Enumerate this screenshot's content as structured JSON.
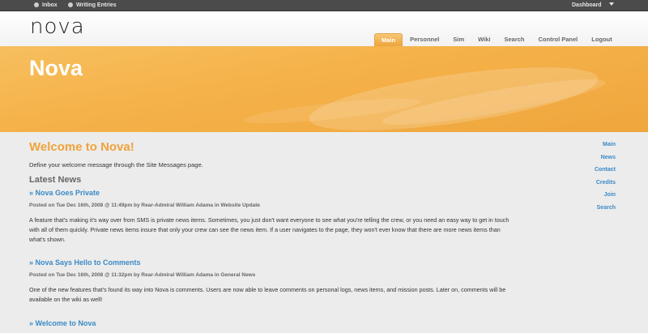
{
  "topbar": {
    "inbox": "Inbox",
    "writing_entries": "Writing Entries",
    "dashboard": "Dashboard"
  },
  "header": {
    "logo": "nova",
    "nav": [
      "Main",
      "Personnel",
      "Sim",
      "Wiki",
      "Search",
      "Control Panel",
      "Logout"
    ],
    "active_tab": "Main"
  },
  "banner": {
    "title": "Nova"
  },
  "main": {
    "welcome_title": "Welcome to Nova!",
    "welcome_message": "Define your welcome message through the Site Messages page.",
    "latest_news_heading": "Latest News",
    "news": [
      {
        "title": "» Nova Goes Private",
        "meta": "Posted on Tue Dec 16th, 2008 @ 11:49pm by Rear-Admiral William Adama in Website Update",
        "body": "A feature that's making it's way over from SMS is private news items. Sometimes, you just don't want everyone to see what you're telling the crew, or you need an easy way to get in touch with all of them quickly. Private news items insure that only your crew can see the news item. If a user navigates to the page, they won't ever know that there are more news items than what's shown."
      },
      {
        "title": "» Nova Says Hello to Comments",
        "meta": "Posted on Tue Dec 16th, 2008 @ 11:32pm by Rear-Admiral William Adama in General News",
        "body": "One of the new features that's found its way into Nova is comments. Users are now able to leave comments on personal logs, news items, and mission posts. Later on, comments will be available on the wiki as well!"
      },
      {
        "title": "» Welcome to Nova"
      }
    ]
  },
  "sidebar": {
    "links": [
      "Main",
      "News",
      "Contact",
      "Credits",
      "Join",
      "Search"
    ]
  },
  "colors": {
    "accent_orange": "#efa33a",
    "link_blue": "#3a8ac7",
    "topbar": "#4b4b4b"
  }
}
